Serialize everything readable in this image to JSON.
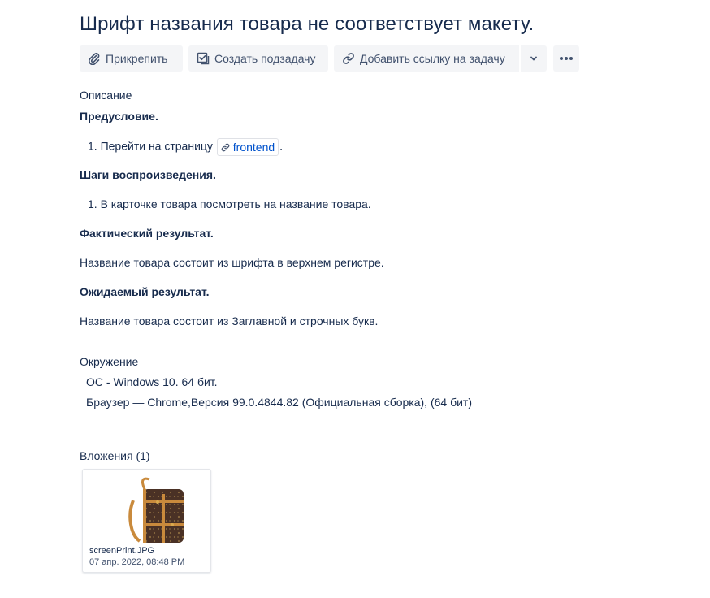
{
  "issue": {
    "title": "Шрифт названия товара не соответствует макету."
  },
  "toolbar": {
    "attach_label": "Прикрепить",
    "attach_icon": "paperclip-icon",
    "subtask_label": "Создать подзадачу",
    "subtask_icon": "checkbox-icon",
    "link_label": "Добавить ссылку на задачу",
    "link_icon": "link-icon",
    "dropdown_icon": "chevron-down-icon",
    "more_icon": "ellipsis-icon"
  },
  "description": {
    "heading": "Описание",
    "precondition_title": "Предусловие.",
    "precondition_step_number": "1.",
    "precondition_step_text": "Перейти на страницу",
    "precondition_link": "frontend",
    "precondition_step_end": ".",
    "steps_title": "Шаги воспроизведения.",
    "steps_item_number": "1.",
    "steps_item_text": "В карточке товара посмотреть на название товара.",
    "actual_title": "Фактический результат.",
    "actual_text": "Название товара состоит из шрифта в верхнем регистре.",
    "expected_title": "Ожидаемый результат.",
    "expected_text": "Название товара состоит из Заглавной и строчных букв."
  },
  "environment": {
    "heading": "Окружение",
    "os_line": "ОС - Windows 10. 64 бит.",
    "browser_line": "Браузер — Chrome,Версия 99.0.4844.82 (Официальная сборка), (64 бит)"
  },
  "attachments": {
    "heading": "Вложения (1)",
    "items": [
      {
        "filename": "screenPrint.JPG",
        "date": "07 апр. 2022, 08:48 PM"
      }
    ]
  },
  "colors": {
    "text": "#172b4d",
    "button_bg": "#f4f5f7",
    "button_text": "#42526e",
    "link": "#0052cc"
  }
}
